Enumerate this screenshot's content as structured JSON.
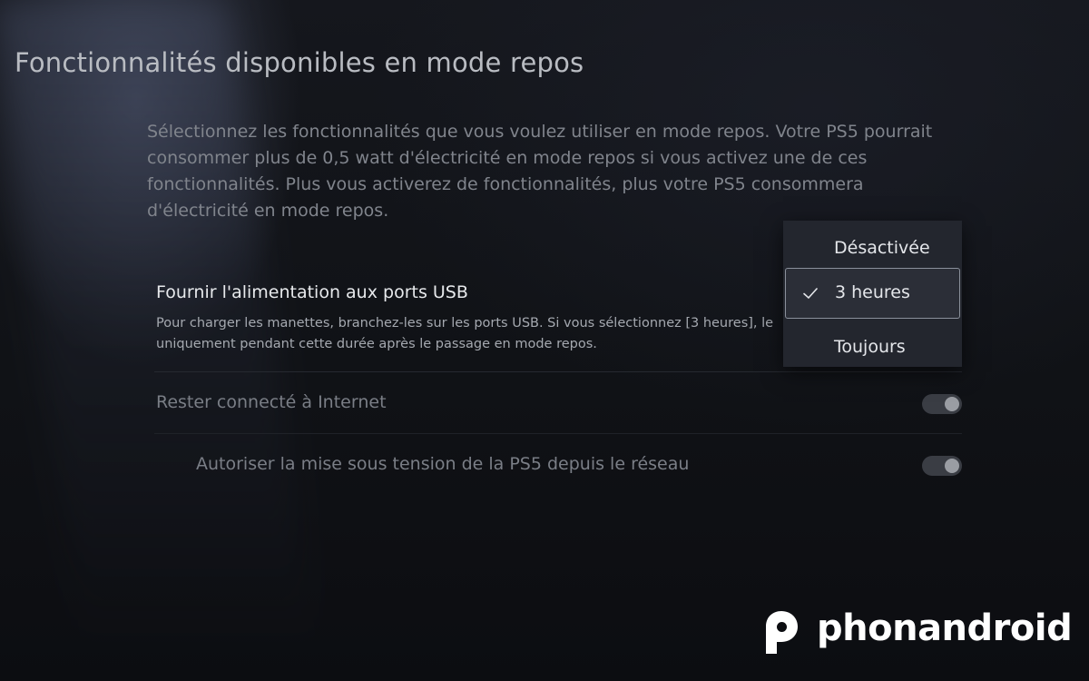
{
  "page": {
    "title": "Fonctionnalités disponibles en mode repos",
    "description": "Sélectionnez les fonctionnalités que vous voulez utiliser en mode repos. Votre PS5 pourrait consommer plus de 0,5 watt d'électricité en mode repos si vous activez une de ces fonctionnalités. Plus vous activerez de fonctionnalités, plus votre PS5 consommera d'électricité en mode repos."
  },
  "settings": [
    {
      "title": "Fournir l'alimentation aux ports USB",
      "description": "Pour charger les manettes, branchez-les sur les ports USB. Si vous sélectionnez [3 heures], le uniquement pendant cette durée après le passage en mode repos."
    },
    {
      "title": "Rester connecté à Internet",
      "toggle_on": true
    },
    {
      "title": "Autoriser la mise sous tension de la PS5 depuis le réseau",
      "toggle_on": true
    }
  ],
  "dropdown": {
    "options": [
      "Désactivée",
      "3 heures",
      "Toujours"
    ],
    "selected": "3 heures",
    "check_icon": "checkmark-icon"
  },
  "watermark": {
    "text": "phonandroid",
    "logo_icon": "phonandroid-logo-icon"
  },
  "colors": {
    "background": "#111318",
    "dropdown_bg": "#23262e",
    "selected_border": "#8a909b",
    "toggle_track": "#3a3d44",
    "toggle_knob": "#9a9da3"
  }
}
